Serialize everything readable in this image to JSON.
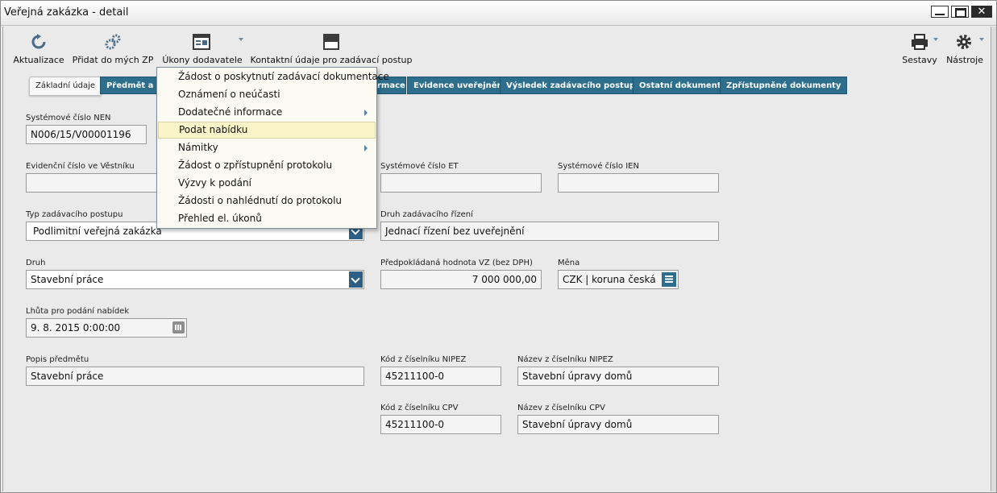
{
  "window": {
    "title": "Veřejná zakázka - detail"
  },
  "toolbar": {
    "refresh": "Aktualizace",
    "add_to_my": "Přidat do mých ZP",
    "supplier_actions": "Úkony dodavatele",
    "contact_info": "Kontaktní údaje pro zadávací postup",
    "reports": "Sestavy",
    "tools": "Nástroje"
  },
  "tabs": [
    "Základní údaje",
    "Předmět a mí",
    "rmace",
    "Evidence uveřejnění",
    "Výsledek zadávacího postupu",
    "Ostatní dokumenty",
    "Zpřístupněné dokumenty"
  ],
  "menu": {
    "items": [
      "Žádost o poskytnutí zadávací dokumentace",
      "Oznámení o neúčasti",
      "Dodatečné informace",
      "Podat nabídku",
      "Námitky",
      "Žádost o zpřístupnění protokolu",
      "Výzvy k podání",
      "Žádosti o nahlédnutí do protokolu",
      "Přehled el. úkonů"
    ],
    "highlighted_index": 3
  },
  "form": {
    "nen_label": "Systémové číslo NEN",
    "nen_value": "N006/15/V00001196",
    "vestnik_label": "Evidenční číslo ve Věstníku",
    "vestnik_value": "",
    "et_label": "Systémové číslo ET",
    "et_value": "",
    "ien_label": "Systémové číslo IEN",
    "ien_value": "",
    "proc_type_label": "Typ zadávacího postupu",
    "proc_type_value": "Podlimitní veřejná zakázka",
    "proc_kind_label": "Druh zadávacího řízení",
    "proc_kind_value": "Jednací řízení bez uveřejnění",
    "kind_label": "Druh",
    "kind_value": "Stavební práce",
    "est_value_label": "Předpokládaná hodnota VZ (bez DPH)",
    "est_value_value": "7 000 000,00",
    "currency_label": "Měna",
    "currency_value": "CZK | koruna česká",
    "deadline_label": "Lhůta pro podání nabídek",
    "deadline_value": "9. 8. 2015 0:00:00",
    "subject_label": "Popis předmětu",
    "subject_value": "Stavební práce",
    "nipez_code_label": "Kód z číselníku NIPEZ",
    "nipez_code_value": "45211100-0",
    "nipez_name_label": "Název z číselníku NIPEZ",
    "nipez_name_value": "Stavební úpravy domů",
    "cpv_code_label": "Kód z číselníku CPV",
    "cpv_code_value": "45211100-0",
    "cpv_name_label": "Název z číselníku CPV",
    "cpv_name_value": "Stavební úpravy domů"
  }
}
